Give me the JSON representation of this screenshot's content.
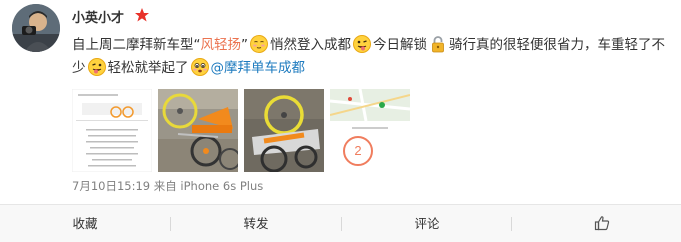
{
  "post": {
    "username": "小英小才",
    "text": {
      "t1": "自上周二摩拜新车型“",
      "t2": "风轻扬",
      "t3": "”",
      "t4": "悄然登入成都",
      "t5": "今日解锁",
      "t6": "骑行真的很轻便很省力，车重轻了不少",
      "t7": "轻松就举起了",
      "mention": "@摩拜单车成都"
    },
    "meta": "7月10日15:19 来自 iPhone 6s Plus",
    "thumb_map_count": "2"
  },
  "actions": {
    "favorite": "收藏",
    "repost": "转发",
    "comment": "评论"
  },
  "icons": {
    "vip": "red-star-icon",
    "like": "thumbs-up-icon",
    "emoji_shy": "shy-face-emoji",
    "emoji_tongue": "tongue-out-emoji",
    "emoji_lock": "lock-icon"
  },
  "colors": {
    "accent": "#eb7350",
    "mention": "#1e7bbf",
    "meta_gray": "#808080",
    "action_bg": "#f8f8f8"
  }
}
